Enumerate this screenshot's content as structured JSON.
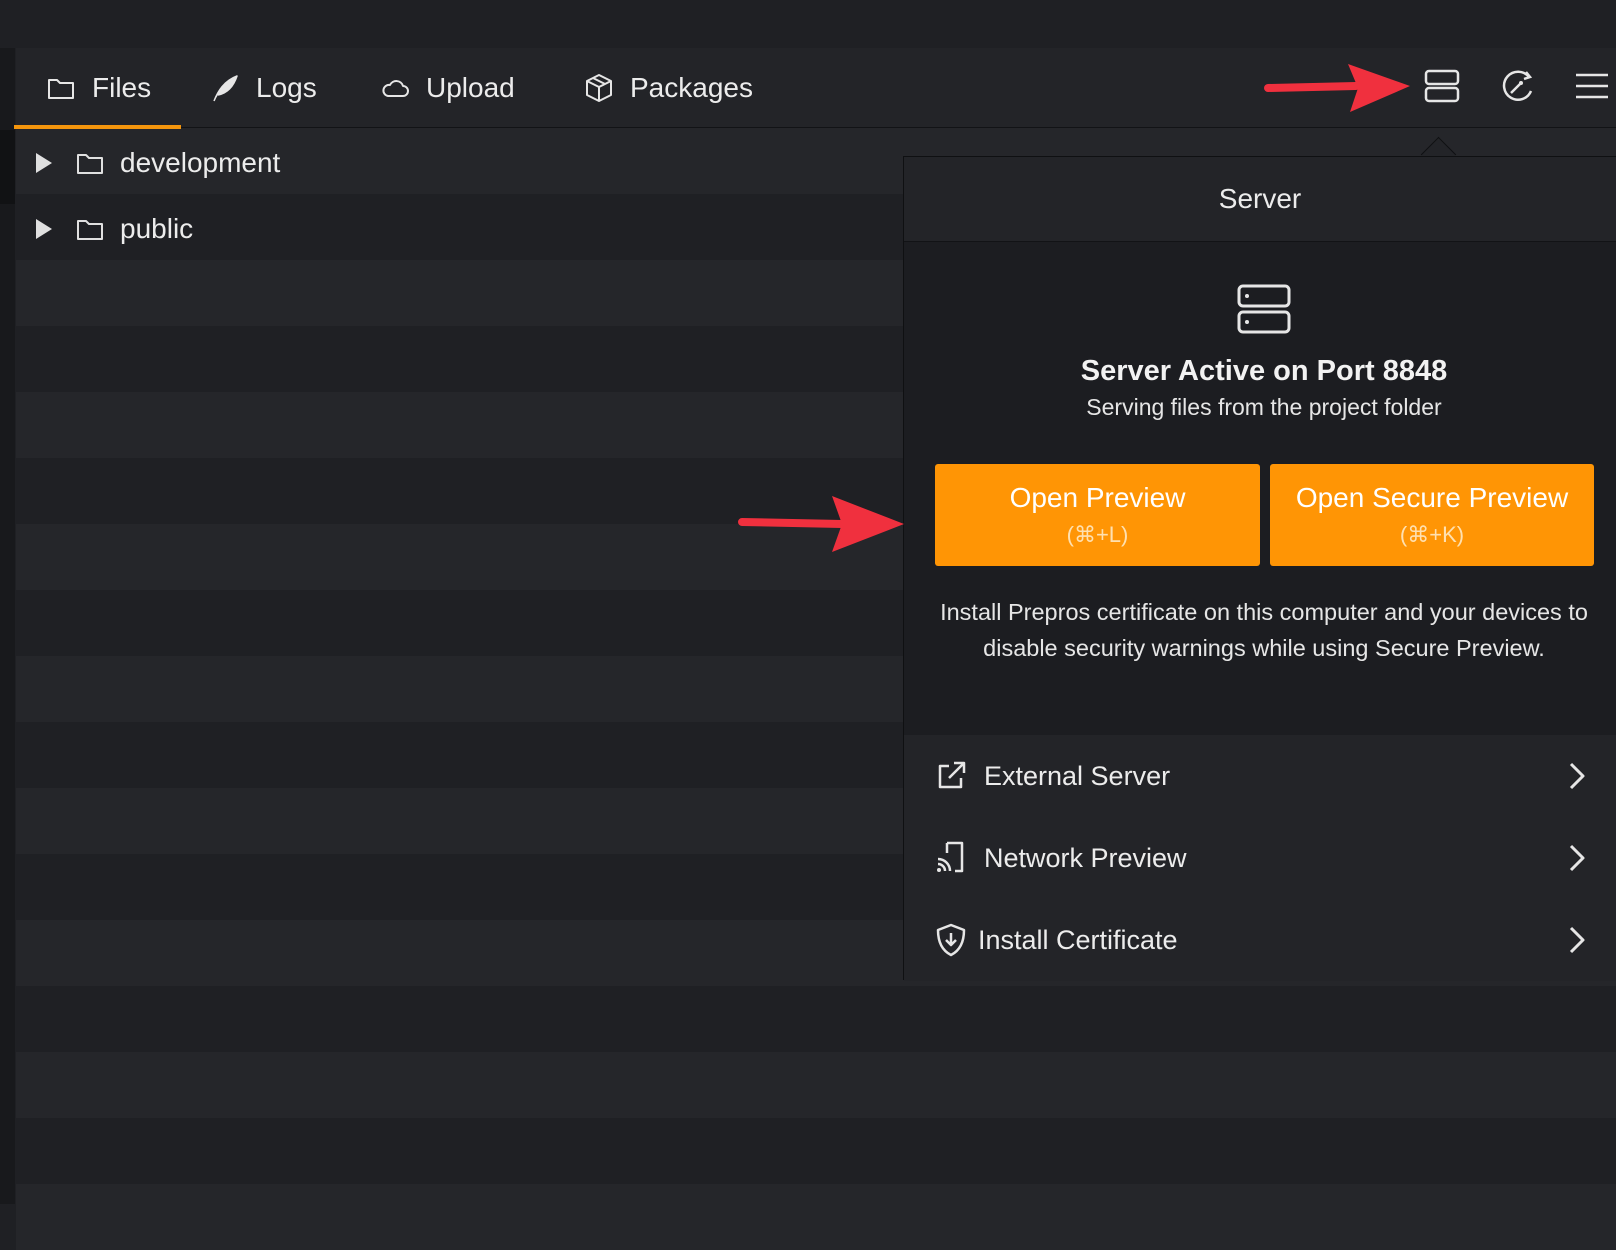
{
  "toolbar": {
    "tabs": [
      {
        "label": "Files",
        "icon": "folder-icon",
        "active": true
      },
      {
        "label": "Logs",
        "icon": "feather-icon",
        "active": false
      },
      {
        "label": "Upload",
        "icon": "cloud-icon",
        "active": false
      },
      {
        "label": "Packages",
        "icon": "package-icon",
        "active": false
      }
    ],
    "right_icons": [
      "server-icon",
      "magic-wand-icon",
      "menu-icon"
    ]
  },
  "files": [
    {
      "name": "development",
      "type": "folder"
    },
    {
      "name": "public",
      "type": "folder"
    }
  ],
  "server_popover": {
    "header": "Server",
    "title": "Server Active on Port 8848",
    "subtitle": "Serving files from the project folder",
    "open_preview": {
      "label": "Open Preview",
      "shortcut": "(⌘+L)"
    },
    "open_secure_preview": {
      "label": "Open Secure Preview",
      "shortcut": "(⌘+K)"
    },
    "note": "Install Prepros certificate on this computer and your devices to disable security warnings while using Secure Preview.",
    "menu": [
      {
        "label": "External Server",
        "icon": "external-link-icon"
      },
      {
        "label": "Network Preview",
        "icon": "cast-icon"
      },
      {
        "label": "Install Certificate",
        "icon": "shield-download-icon"
      }
    ]
  },
  "colors": {
    "accent": "#ff9505",
    "tab_underline": "#f5960d",
    "annotation_arrow": "#f0303e",
    "background": "#1f2024"
  }
}
